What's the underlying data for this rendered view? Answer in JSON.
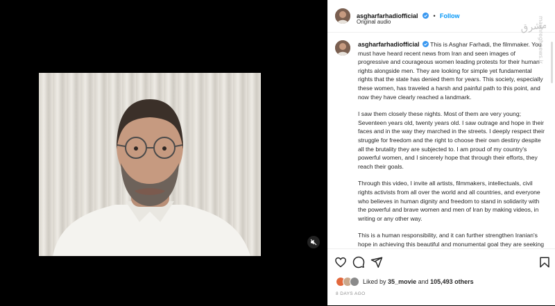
{
  "header": {
    "username": "asgharfarhadiofficial",
    "follow_label": "Follow",
    "audio_label": "Original audio",
    "separator": "•"
  },
  "caption": {
    "username": "asgharfarhadiofficial",
    "paragraphs": [
      "This is Asghar Farhadi, the filmmaker. You must have heard recent news from Iran and seen images of progressive and courageous women leading protests for their human rights alongside men. They are looking for simple yet fundamental rights that the state has denied them for years. This society, especially these women, has traveled a harsh and painful path to this point, and now they have clearly reached a landmark.",
      "I saw them closely these nights. Most of them are very young; Seventeen years old, twenty years old. I saw outrage and hope in their faces and in the way they marched in the streets. I deeply respect their struggle for freedom and the right to choose their own destiny despite all the brutality they are subjected to. I am proud of my country's powerful women, and I sincerely hope that through their efforts, they reach their goals.",
      "Through this video, I invite all artists, filmmakers, intellectuals, civil rights activists from all over the world and all countries, and everyone who believes in human dignity and freedom to stand in solidarity with the powerful and brave women and men of Iran by making videos, in writing or any other way.",
      "This is a human responsibility, and it can further strengthen Iranian's hope in achieving this beautiful and monumental goal they are seeking here, the country where I have no doubt women"
    ]
  },
  "likes": {
    "prefix": "Liked by",
    "user": "35_movie",
    "middle": "and",
    "others": "105,493 others"
  },
  "date": "8 DAYS AGO",
  "watermark": "mashreghnews.ir",
  "colors": {
    "accent": "#0095f6",
    "verified": "#3897f0",
    "muted": "#8e8e8e"
  },
  "icons": [
    "heart-icon",
    "comment-icon",
    "share-icon",
    "bookmark-icon",
    "mute-icon",
    "verified-icon"
  ]
}
